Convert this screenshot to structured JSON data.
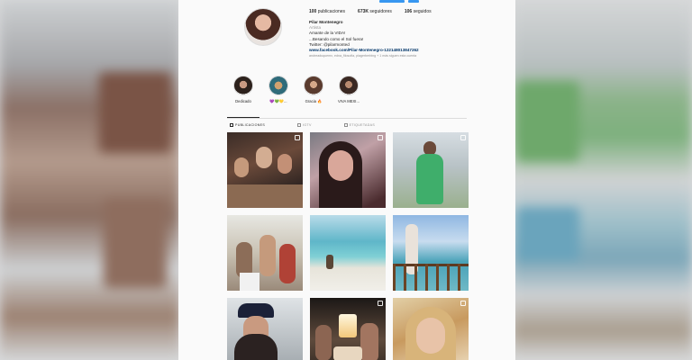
{
  "profile": {
    "stats": [
      {
        "count": "100",
        "label": "publicaciones"
      },
      {
        "count": "673K",
        "label": "seguidores"
      },
      {
        "count": "106",
        "label": "seguidos"
      }
    ],
    "name": "Pilar Montenegro",
    "category": "Artista",
    "bio_lines": [
      "Amante de la VIDA!",
      "...Besando como el Sol fuera!",
      "Twitter: @pilarmonted"
    ],
    "link": "www.facebook.com/Pilar-Montenegro-122148013847262",
    "followed_by": "andreaduquemx, edna_filosofia, piagerberbing + 1 más siguen esta cuenta"
  },
  "highlights": [
    {
      "label": "Dedicado"
    },
    {
      "label": "💜💚💛..."
    },
    {
      "label": "Gracia 🔥"
    },
    {
      "label": "VIVA MEXI..."
    }
  ],
  "tabs": [
    {
      "label": "PUBLICACIONES",
      "active": true
    },
    {
      "label": "IGTV",
      "active": false
    },
    {
      "label": "ETIQUETADAS",
      "active": false
    }
  ],
  "colors": {
    "accent": "#3897f0",
    "text": "#262626",
    "muted": "#8e8e8e",
    "link": "#003569"
  }
}
